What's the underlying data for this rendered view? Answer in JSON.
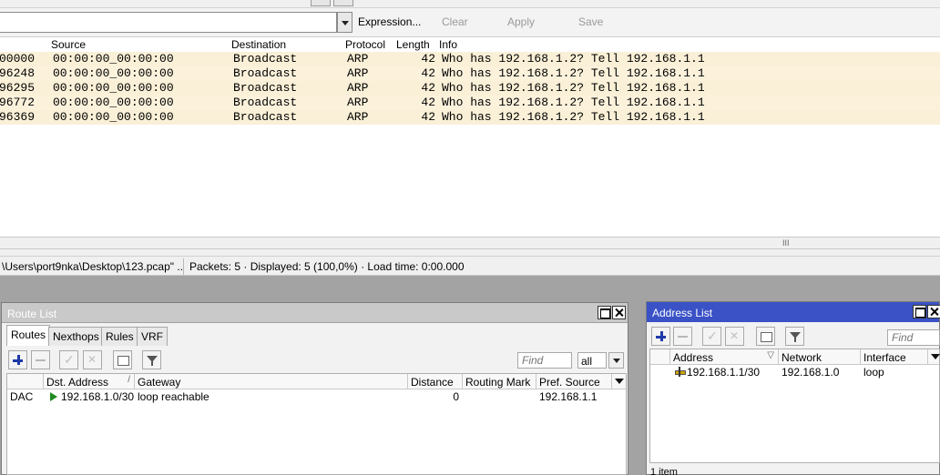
{
  "wireshark": {
    "filter": {
      "value": "",
      "expression_label": "Expression...",
      "clear_label": "Clear",
      "apply_label": "Apply",
      "save_label": "Save"
    },
    "columns": [
      "Source",
      "Destination",
      "Protocol",
      "Length",
      "Info"
    ],
    "packets": [
      {
        "time": "00000",
        "source": "00:00:00_00:00:00",
        "destination": "Broadcast",
        "protocol": "ARP",
        "length": "42",
        "info": "Who has 192.168.1.2?  Tell 192.168.1.1"
      },
      {
        "time": "96248",
        "source": "00:00:00_00:00:00",
        "destination": "Broadcast",
        "protocol": "ARP",
        "length": "42",
        "info": "Who has 192.168.1.2?  Tell 192.168.1.1"
      },
      {
        "time": "96295",
        "source": "00:00:00_00:00:00",
        "destination": "Broadcast",
        "protocol": "ARP",
        "length": "42",
        "info": "Who has 192.168.1.2?  Tell 192.168.1.1"
      },
      {
        "time": "96772",
        "source": "00:00:00_00:00:00",
        "destination": "Broadcast",
        "protocol": "ARP",
        "length": "42",
        "info": "Who has 192.168.1.2?  Tell 192.168.1.1"
      },
      {
        "time": "96369",
        "source": "00:00:00_00:00:00",
        "destination": "Broadcast",
        "protocol": "ARP",
        "length": "42",
        "info": "Who has 192.168.1.2?  Tell 192.168.1.1"
      }
    ],
    "splitter_grip": "III",
    "status": {
      "file": "\\Users\\port9nka\\Desktop\\123.pcap\" ...",
      "stats": "Packets: 5 · Displayed: 5 (100,0%) · Load time: 0:00.000"
    }
  },
  "route_list": {
    "title": "Route List",
    "tabs": [
      "Routes",
      "Nexthops",
      "Rules",
      "VRF"
    ],
    "find_placeholder": "Find",
    "filter_select": "all",
    "columns": [
      "Dst. Address",
      "Gateway",
      "Distance",
      "Routing Mark",
      "Pref. Source"
    ],
    "rows": [
      {
        "flags": "DAC",
        "dst_address": "192.168.1.0/30",
        "gateway": "loop reachable",
        "distance": "0",
        "routing_mark": "",
        "pref_source": "192.168.1.1"
      }
    ]
  },
  "address_list": {
    "title": "Address List",
    "find_placeholder": "Find",
    "columns": [
      "Address",
      "Network",
      "Interface"
    ],
    "rows": [
      {
        "address": "192.168.1.1/30",
        "network": "192.168.1.0",
        "interface": "loop"
      }
    ],
    "status": "1 item"
  },
  "colors": {
    "packet_row": "#faf0d7",
    "address_title_bar": "#3a52c6",
    "route_title_bar": "#c9c9c9",
    "desktop": "#a3a3a3"
  }
}
